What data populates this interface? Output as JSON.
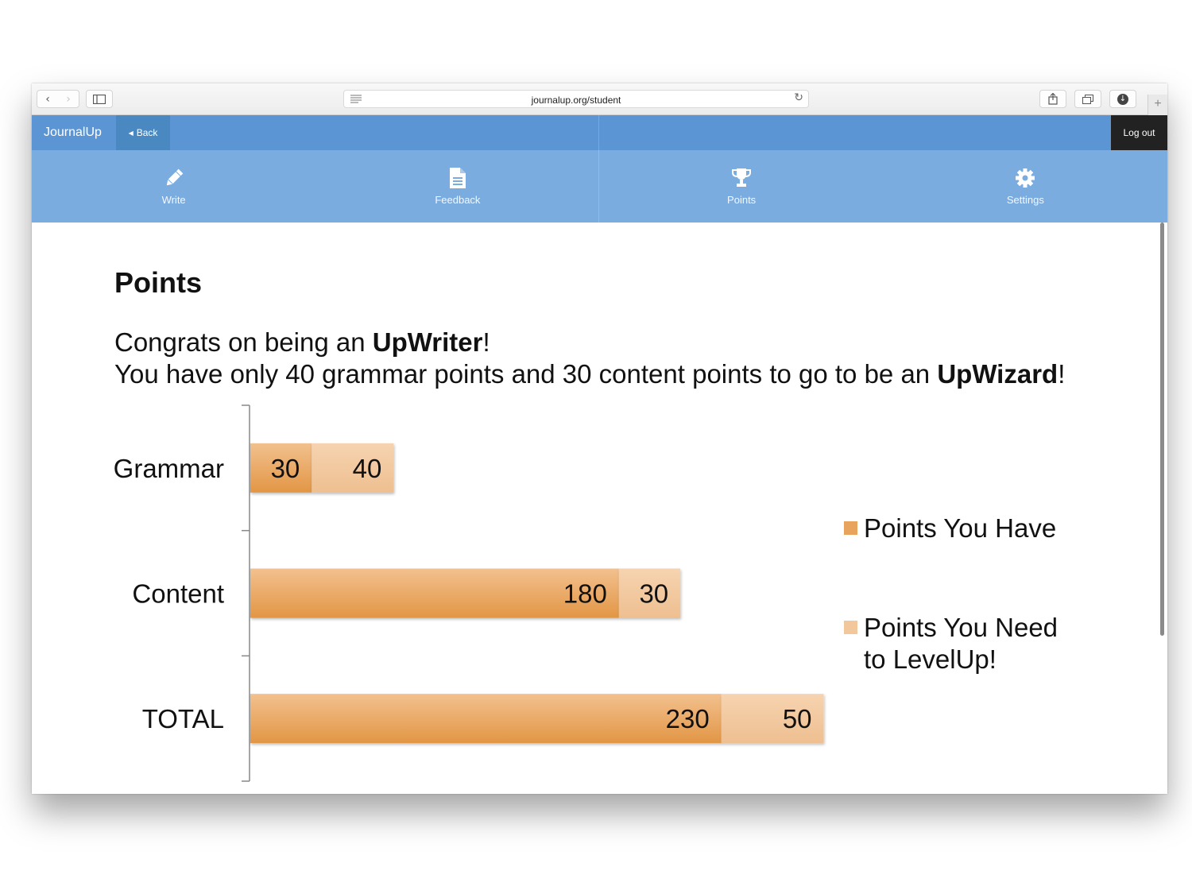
{
  "browser": {
    "back_icon": "‹",
    "forward_icon": "›",
    "url": "journalup.org/student",
    "new_tab_icon": "+"
  },
  "header": {
    "brand": "JournalUp",
    "back_label": "Back",
    "logout_label": "Log out"
  },
  "nav": {
    "tabs": [
      {
        "label": "Write",
        "icon": "pencil-icon"
      },
      {
        "label": "Feedback",
        "icon": "document-icon"
      },
      {
        "label": "Points",
        "icon": "trophy-icon"
      },
      {
        "label": "Settings",
        "icon": "gear-icon"
      }
    ]
  },
  "main": {
    "title": "Points",
    "congrats_prefix": "Congrats on being an ",
    "congrats_level": "UpWriter",
    "congrats_suffix": "!",
    "progress_prefix": "You have only 40 grammar points and 30 content points to go to be an ",
    "progress_level": "UpWizard",
    "progress_suffix": "!"
  },
  "colors": {
    "header_blue": "#5c95d4",
    "nav_blue": "#7aace0",
    "have_color": "#e8a45c",
    "need_color": "#f2c79b"
  },
  "chart_data": {
    "type": "bar",
    "orientation": "horizontal",
    "stacked": true,
    "categories": [
      "Grammar",
      "Content",
      "TOTAL"
    ],
    "series": [
      {
        "name": "Points You Have",
        "values": [
          30,
          180,
          230
        ]
      },
      {
        "name": "Points You Need to LevelUp!",
        "values": [
          40,
          30,
          50
        ]
      }
    ],
    "legend": {
      "have": "Points You Have",
      "need_line1": "Points You Need",
      "need_line2": "to LevelUp!",
      "position": "right"
    },
    "xlim": [
      0,
      280
    ],
    "data_labels": true,
    "grid": false
  }
}
